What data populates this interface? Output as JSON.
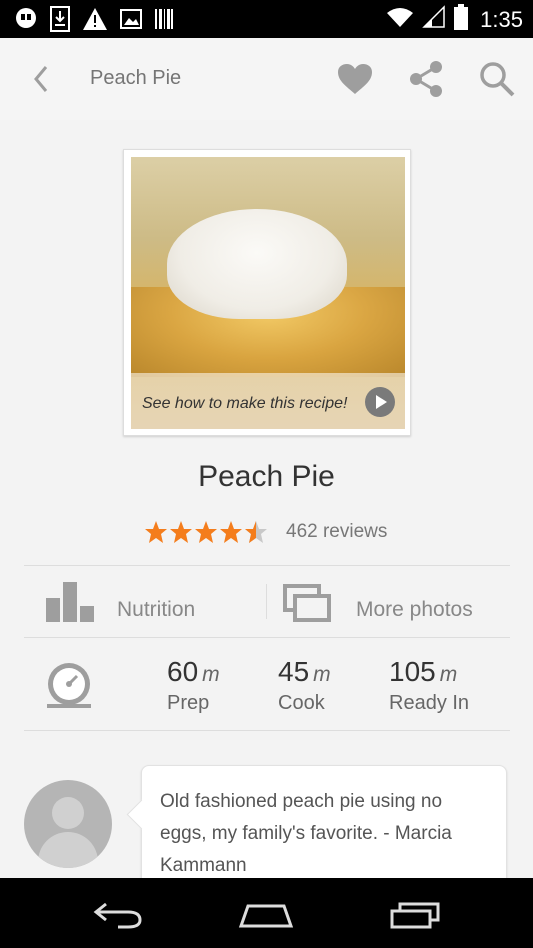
{
  "status_bar": {
    "time": "1:35",
    "left_icons": [
      "hangouts-icon",
      "download-icon",
      "warning-icon",
      "image-icon",
      "barcode-icon"
    ],
    "right_icons": [
      "wifi-icon",
      "signal-icon",
      "battery-icon"
    ]
  },
  "app_bar": {
    "title": "Peach Pie",
    "actions": [
      "back-icon",
      "heart-icon",
      "share-icon",
      "search-icon"
    ]
  },
  "recipe": {
    "photo_caption": "See how to make this recipe!",
    "title": "Peach Pie",
    "rating": 4.5,
    "rating_max": 5,
    "reviews": "462 reviews"
  },
  "links": {
    "nutrition": "Nutrition",
    "more_photos": "More photos"
  },
  "times": [
    {
      "value": "60",
      "unit": "m",
      "label": "Prep"
    },
    {
      "value": "45",
      "unit": "m",
      "label": "Cook"
    },
    {
      "value": "105",
      "unit": "m",
      "label": "Ready In"
    }
  ],
  "review": {
    "text": "Old fashioned peach pie using no eggs, my family's favorite. - Marcia Kammann"
  },
  "colors": {
    "star": "#f47d1c",
    "star_empty": "#c8c8c8",
    "icon_gray": "#9e9e9e",
    "app_bar_bg": "#f5f5f5",
    "page_bg": "#f3f3f3"
  }
}
